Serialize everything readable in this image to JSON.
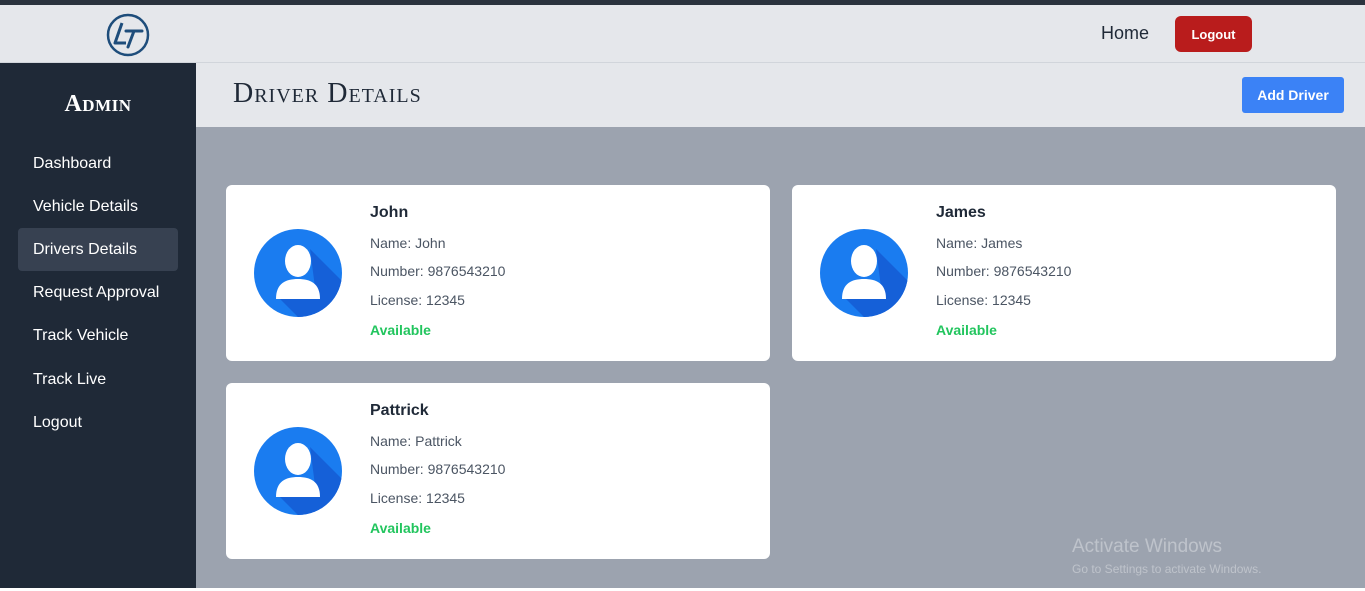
{
  "navbar": {
    "logo_icon": "lt-logo-icon",
    "home_label": "Home",
    "logout_label": "Logout"
  },
  "sidebar": {
    "title": "Admin",
    "items": [
      {
        "label": "Dashboard",
        "active": false
      },
      {
        "label": "Vehicle Details",
        "active": false
      },
      {
        "label": "Drivers Details",
        "active": true
      },
      {
        "label": "Request Approval",
        "active": false
      },
      {
        "label": "Track Vehicle",
        "active": false
      },
      {
        "label": "Track Live",
        "active": false
      },
      {
        "label": "Logout",
        "active": false
      }
    ]
  },
  "header": {
    "title": "Driver Details",
    "add_button_label": "Add Driver"
  },
  "drivers": [
    {
      "heading": "John",
      "name": "Name: John",
      "number": "Number: 9876543210",
      "license": "License: 12345",
      "status": "Available"
    },
    {
      "heading": "James",
      "name": "Name: James",
      "number": "Number: 9876543210",
      "license": "License: 12345",
      "status": "Available"
    },
    {
      "heading": "Pattrick",
      "name": "Name: Pattrick",
      "number": "Number: 9876543210",
      "license": "License: 12345",
      "status": "Available"
    }
  ],
  "watermark": {
    "title": "Activate Windows",
    "subtitle": "Go to Settings to activate Windows."
  },
  "colors": {
    "sidebar_bg": "#1f2937",
    "accent_blue": "#3b82f6",
    "logout_red": "#b91c1c",
    "status_green": "#22c55e",
    "content_bg": "#9ca3af"
  }
}
